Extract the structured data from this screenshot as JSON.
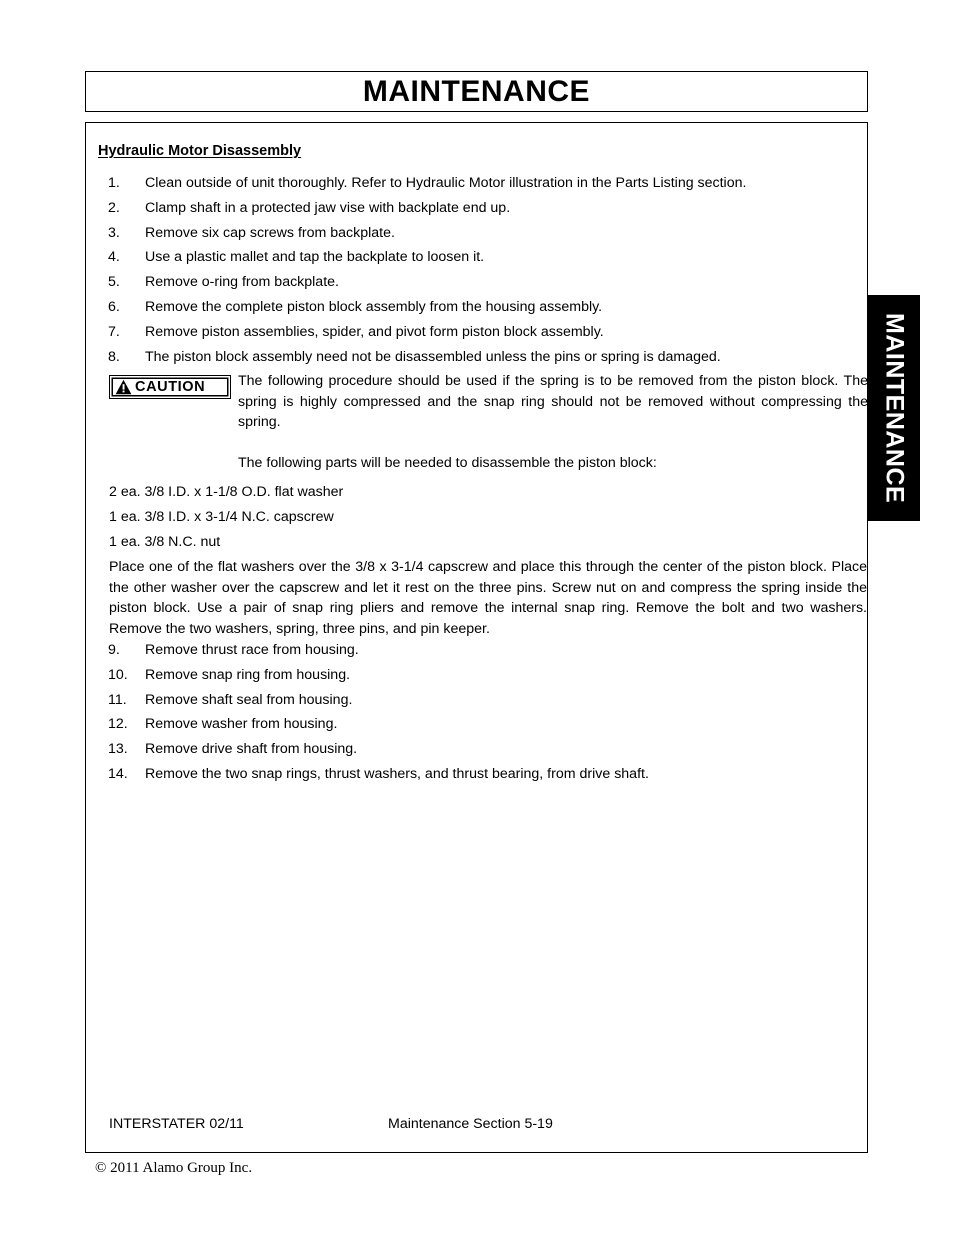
{
  "header": {
    "title": "MAINTENANCE"
  },
  "side_tab": {
    "label": "MAINTENANCE",
    "background_color": "#000000",
    "text_color": "#ffffff"
  },
  "content": {
    "section_heading": "Hydraulic Motor Disassembly",
    "steps_first": [
      {
        "num": "1.",
        "text": "Clean outside of unit thoroughly.  Refer to Hydraulic Motor illustration in the Parts Listing section."
      },
      {
        "num": "2.",
        "text": "Clamp shaft in a protected jaw vise with backplate end up."
      },
      {
        "num": "3.",
        "text": "Remove six cap screws from backplate."
      },
      {
        "num": "4.",
        "text": "Use a plastic mallet and tap the backplate to loosen it."
      },
      {
        "num": "5.",
        "text": "Remove o-ring from backplate."
      },
      {
        "num": "6.",
        "text": "Remove the complete piston block assembly from the housing assembly."
      },
      {
        "num": "7.",
        "text": "Remove piston assemblies, spider, and pivot form piston block assembly."
      },
      {
        "num": "8.",
        "text": "The piston block assembly need not be disassembled unless the pins or spring is damaged."
      }
    ],
    "caution": {
      "badge_label": "CAUTION",
      "icon": "warning-triangle-icon",
      "text": "The following procedure should be used if the spring is to be removed from the piston block. The spring is highly compressed and the snap ring should not be removed without compressing the spring."
    },
    "parts_intro": "The following parts will be needed to disassemble the piston block:",
    "parts": [
      "2 ea. 3/8 I.D. x 1-1/8 O.D. flat washer",
      "1 ea. 3/8 I.D. x 3-1/4 N.C. capscrew",
      "1 ea. 3/8 N.C. nut"
    ],
    "body_paragraph": "Place one of the flat washers over the 3/8 x 3-1/4 capscrew and place this through the center of the piston block.  Place the other washer over the capscrew and let it rest on the three pins.  Screw nut on and compress the spring inside the piston block.  Use a pair of snap ring pliers and remove the internal snap ring.  Remove the bolt and two washers.  Remove the two washers, spring, three pins, and pin keeper.",
    "steps_second": [
      {
        "num": "9.",
        "text": "Remove thrust race from housing."
      },
      {
        "num": "10.",
        "text": "Remove snap ring from housing."
      },
      {
        "num": "11.",
        "text": "Remove shaft seal from housing."
      },
      {
        "num": "12.",
        "text": "Remove washer from housing."
      },
      {
        "num": "13.",
        "text": "Remove drive shaft from housing."
      },
      {
        "num": "14.",
        "text": "Remove the two snap rings, thrust washers, and thrust bearing, from drive shaft."
      }
    ]
  },
  "footer": {
    "left": "INTERSTATER   02/11",
    "center": "Maintenance Section 5-19",
    "copyright": "© 2011 Alamo Group Inc."
  }
}
